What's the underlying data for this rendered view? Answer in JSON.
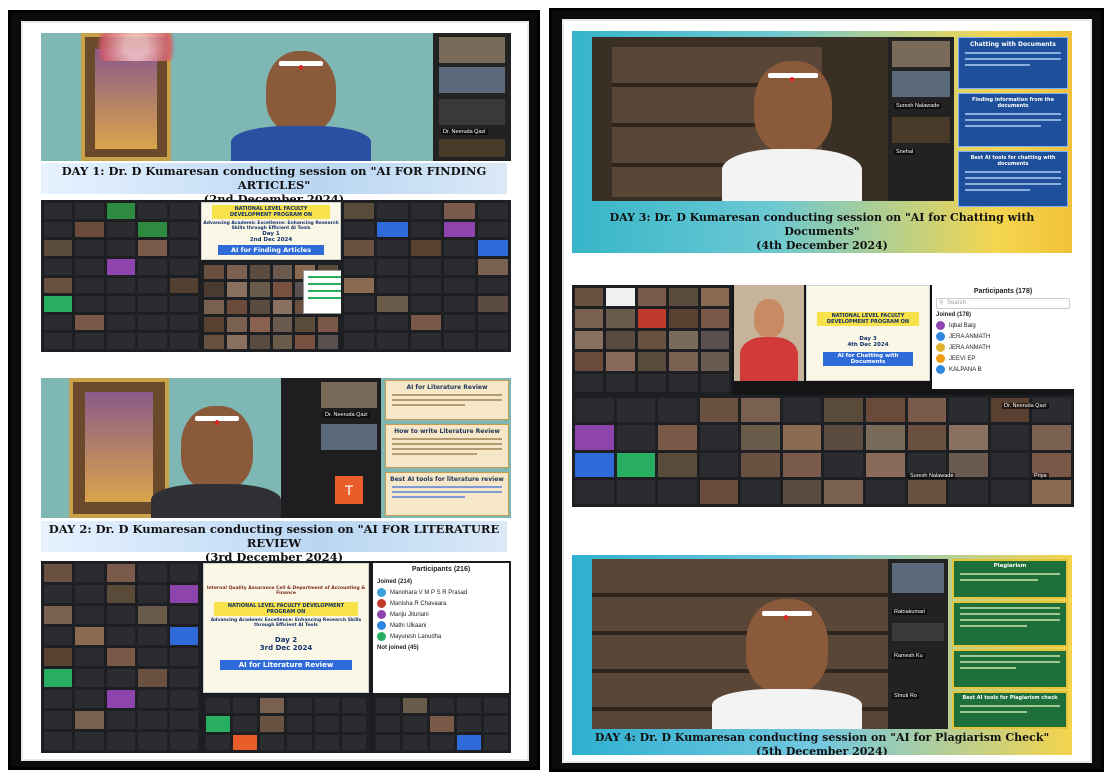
{
  "left_panel": {
    "day1": {
      "caption_line1": "DAY 1: Dr. D Kumaresan conducting session on \"AI FOR FINDING ARTICLES\"",
      "caption_line2": "(2nd December 2024)",
      "side_name": "Dr. Neeruda Qazi"
    },
    "gallery1": {
      "slide_title": "NATIONAL LEVEL FACULTY DEVELOPMENT PROGRAM ON",
      "slide_sub": "Advancing Academic Excellence: Enhancing Research Skills through Efficient AI Tools",
      "slide_day": "Day 1",
      "slide_date": "2nd Dec 2024",
      "slide_topic": "AI for Finding Articles"
    },
    "day2": {
      "caption_line1": "DAY 2: Dr. D Kumaresan conducting session on \"AI FOR LITERATURE REVIEW",
      "caption_line2": "(3rd December 2024)",
      "side_name": "Dr. Neeruda Qazi",
      "slide1_title": "AI for Literature Review",
      "slide2_title": "How to write Literature Review",
      "slide3_title": "Best AI tools for literature review"
    },
    "gallery2": {
      "slide_header": "Internal Quality Assurance Cell & Department of Accounting & Finance",
      "slide_title": "NATIONAL LEVEL FACULTY DEVELOPMENT PROGRAM ON",
      "slide_sub": "Advancing Academic Excellence: Enhancing Research Skills through Efficient AI Tools",
      "slide_day": "Day 2",
      "slide_date": "3rd Dec 2024",
      "slide_topic": "AI for Literature Review",
      "participants_title": "Participants (216)",
      "joined_label": "Joined (214)",
      "participants": [
        {
          "name": "Manohara V M P S R Prasad",
          "color": "#3aa0d8"
        },
        {
          "name": "Manisha R Chavaara",
          "color": "#c0392b"
        },
        {
          "name": "Manju Jituriani",
          "color": "#8e44ad"
        },
        {
          "name": "Mathi Ulkaani",
          "color": "#2e86de"
        },
        {
          "name": "Mayuresh Lanudha",
          "color": "#27ae60"
        }
      ],
      "not_joined_label": "Not joined (45)"
    }
  },
  "right_panel": {
    "day3": {
      "caption_line1": "DAY 3: Dr. D Kumaresan conducting session on \"AI for Chatting with Documents\"",
      "caption_line2": "(4th December 2024)",
      "box1_title": "Chatting with Documents",
      "box2_title": "Finding information from the documents",
      "box3_title": "Best AI tools for chatting with documents",
      "side_names": [
        "Suresh Nalawade",
        "Snehal"
      ]
    },
    "gallery3": {
      "slide_title": "NATIONAL LEVEL FACULTY DEVELOPMENT PROGRAM ON",
      "slide_day": "Day 3",
      "slide_date": "4th Dec 2024",
      "slide_topic": "AI for Chatting with Documents",
      "participants_title": "Participants (178)",
      "search_placeholder": "Search",
      "joined_label": "Joined (178)",
      "participants": [
        {
          "name": "Iqbal Baig",
          "color": "#8e44ad"
        },
        {
          "name": "JERA ANMATH",
          "color": "#2e86de"
        },
        {
          "name": "JERA ANMATH",
          "color": "#e1b12c"
        },
        {
          "name": "JEEVI EP",
          "color": "#f39c12"
        },
        {
          "name": "KALPANA B",
          "color": "#2e86de"
        }
      ],
      "tile_names": [
        "Dr. Neeruda Qazi",
        "Suresh Nalawade",
        "Priya"
      ]
    },
    "day4": {
      "caption_line1": "DAY 4: Dr. D Kumaresan conducting session on \"AI for Plagiarism Check\"",
      "caption_line2": "(5th December 2024)",
      "box1_title": "Plagiarism",
      "box4_title": "Best AI tools for Plagiarism check",
      "side_names": [
        "Ratnakumari",
        "Ramesh Ku",
        "Shruti Ro"
      ]
    }
  }
}
